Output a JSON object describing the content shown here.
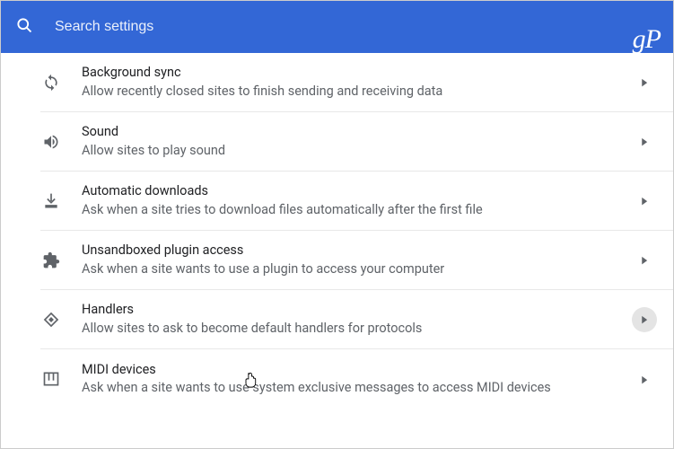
{
  "search": {
    "placeholder": "Search settings"
  },
  "brand": "gP",
  "rows": [
    {
      "icon": "sync",
      "title": "Background sync",
      "desc": "Allow recently closed sites to finish sending and receiving data"
    },
    {
      "icon": "sound",
      "title": "Sound",
      "desc": "Allow sites to play sound"
    },
    {
      "icon": "download",
      "title": "Automatic downloads",
      "desc": "Ask when a site tries to download files automatically after the first file"
    },
    {
      "icon": "plugin",
      "title": "Unsandboxed plugin access",
      "desc": "Ask when a site wants to use a plugin to access your computer"
    },
    {
      "icon": "handlers",
      "title": "Handlers",
      "desc": "Allow sites to ask to become default handlers for protocols",
      "hovered": true
    },
    {
      "icon": "midi",
      "title": "MIDI devices",
      "desc": "Ask when a site wants to use system exclusive messages to access MIDI devices"
    }
  ]
}
